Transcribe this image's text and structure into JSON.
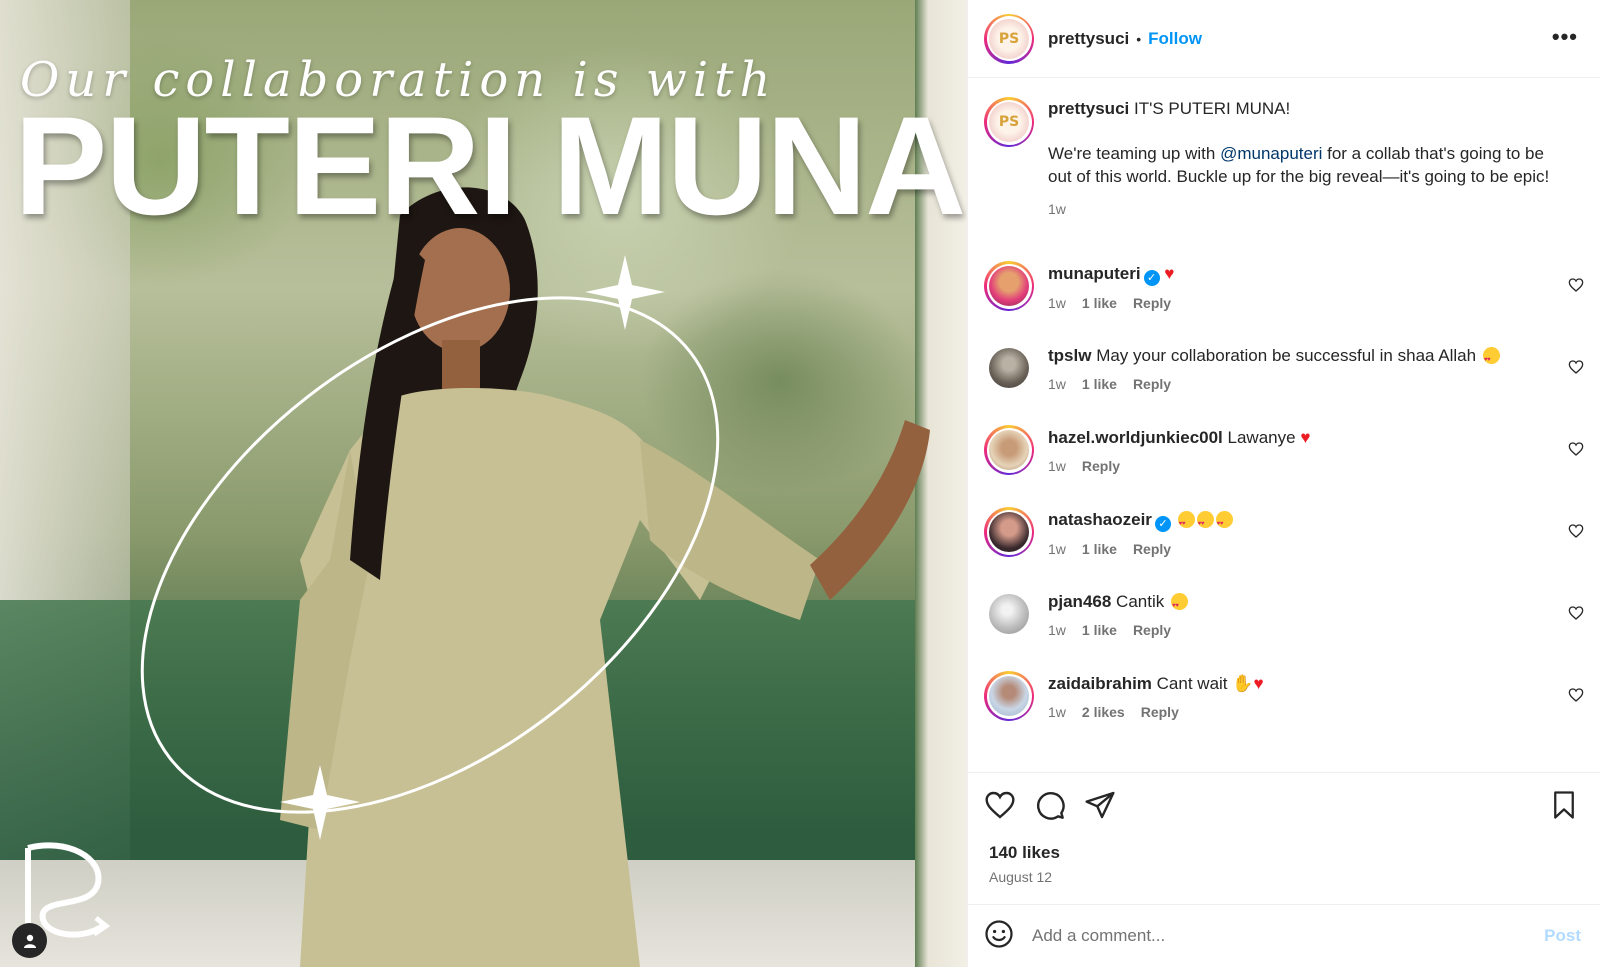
{
  "post_image": {
    "subtitle": "Our collaboration is with",
    "headline": "PUTERI MUNA"
  },
  "header": {
    "username": "prettysuci",
    "separator": "•",
    "follow_label": "Follow",
    "more_label": "•••"
  },
  "caption": {
    "username": "prettysuci",
    "line1": "IT'S PUTERI MUNA!",
    "p2_before": "We're teaming up with ",
    "mention": "@munaputeri",
    "p2_after": " for a collab that's going to be out of this world. Buckle up for the big reveal—it's going to be epic!",
    "time": "1w"
  },
  "comments": [
    {
      "username": "munaputeri",
      "verified": true,
      "text": "",
      "time": "1w",
      "likes": "1 like",
      "reply": "Reply"
    },
    {
      "username": "tpslw",
      "verified": false,
      "text": "May your collaboration be successful in shaa Allah",
      "time": "1w",
      "likes": "1 like",
      "reply": "Reply"
    },
    {
      "username": "hazel.worldjunkiec00l",
      "verified": false,
      "text": "Lawanye",
      "time": "1w",
      "likes": "",
      "reply": "Reply"
    },
    {
      "username": "natashaozeir",
      "verified": true,
      "text": "",
      "time": "1w",
      "likes": "1 like",
      "reply": "Reply"
    },
    {
      "username": "pjan468",
      "verified": false,
      "text": "Cantik",
      "time": "1w",
      "likes": "1 like",
      "reply": "Reply"
    },
    {
      "username": "zaidaibrahim",
      "verified": false,
      "text": "Cant wait",
      "time": "1w",
      "likes": "2 likes",
      "reply": "Reply"
    }
  ],
  "footer": {
    "likes": "140 likes",
    "date": "August 12"
  },
  "add_comment": {
    "placeholder": "Add a comment...",
    "post_label": "Post"
  },
  "colors": {
    "link_blue": "#0095f6",
    "mention_blue": "#00376b",
    "muted_text": "#737373",
    "post_disabled": "#b3dbff"
  },
  "icons": [
    "more-icon",
    "heart-icon",
    "comment-icon",
    "share-icon",
    "bookmark-icon",
    "emoji-icon",
    "verified-badge-icon",
    "user-tag-icon"
  ]
}
